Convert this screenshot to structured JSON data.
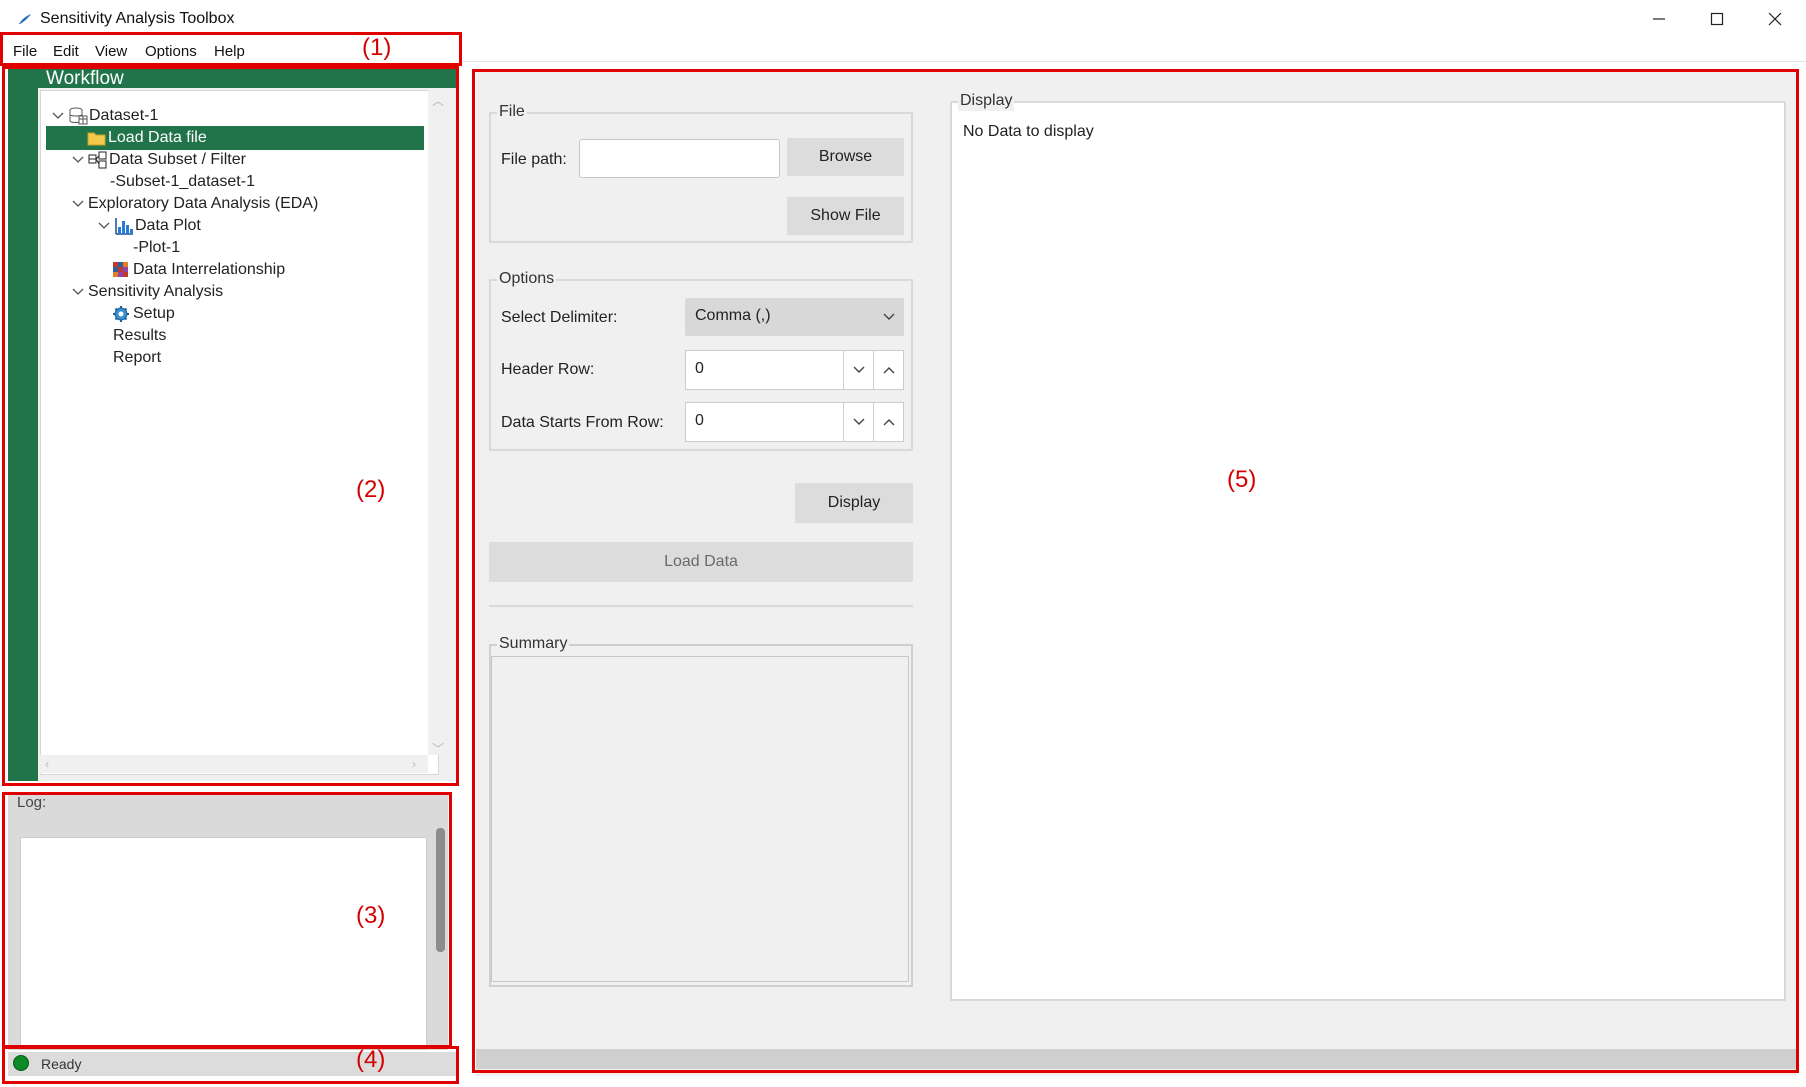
{
  "window": {
    "title": "Sensitivity Analysis Toolbox",
    "minimize_glyph": "—",
    "maximize_glyph": "☐",
    "close_glyph": "✕"
  },
  "menu": [
    "File",
    "Edit",
    "View",
    "Options",
    "Help"
  ],
  "workflow": {
    "header": "Workflow",
    "nodes": {
      "dataset": "Dataset-1",
      "load_data": "Load Data file",
      "subset": "Data Subset / Filter",
      "subset_item": "-Subset-1_dataset-1",
      "eda": "Exploratory Data Analysis (EDA)",
      "data_plot": "Data Plot",
      "plot_item": "-Plot-1",
      "interrelationship": "Data Interrelationship",
      "sensitivity": "Sensitivity Analysis",
      "setup": "Setup",
      "results": "Results",
      "report": "Report"
    },
    "selected": "Load Data file"
  },
  "log": {
    "label": "Log:",
    "content": ""
  },
  "status": {
    "text": "Ready",
    "indicator_color": "#0c8a25"
  },
  "file_group": {
    "title": "File",
    "path_label": "File path:",
    "path_value": "",
    "browse": "Browse",
    "show_file": "Show File"
  },
  "options_group": {
    "title": "Options",
    "delimiter_label": "Select Delimiter:",
    "delimiter_value": "Comma (,)",
    "header_row_label": "Header Row:",
    "header_row_value": "0",
    "data_start_label": "Data Starts From Row:",
    "data_start_value": "0"
  },
  "actions": {
    "display": "Display",
    "load_data": "Load Data"
  },
  "summary": {
    "title": "Summary",
    "content": ""
  },
  "display_group": {
    "title": "Display",
    "message": "No Data to display"
  },
  "annotations": [
    "(1)",
    "(2)",
    "(3)",
    "(4)",
    "(5)"
  ],
  "colors": {
    "accent_green": "#21744a",
    "annotation_red": "#e00000",
    "panel_bg": "#f0f0f0"
  }
}
